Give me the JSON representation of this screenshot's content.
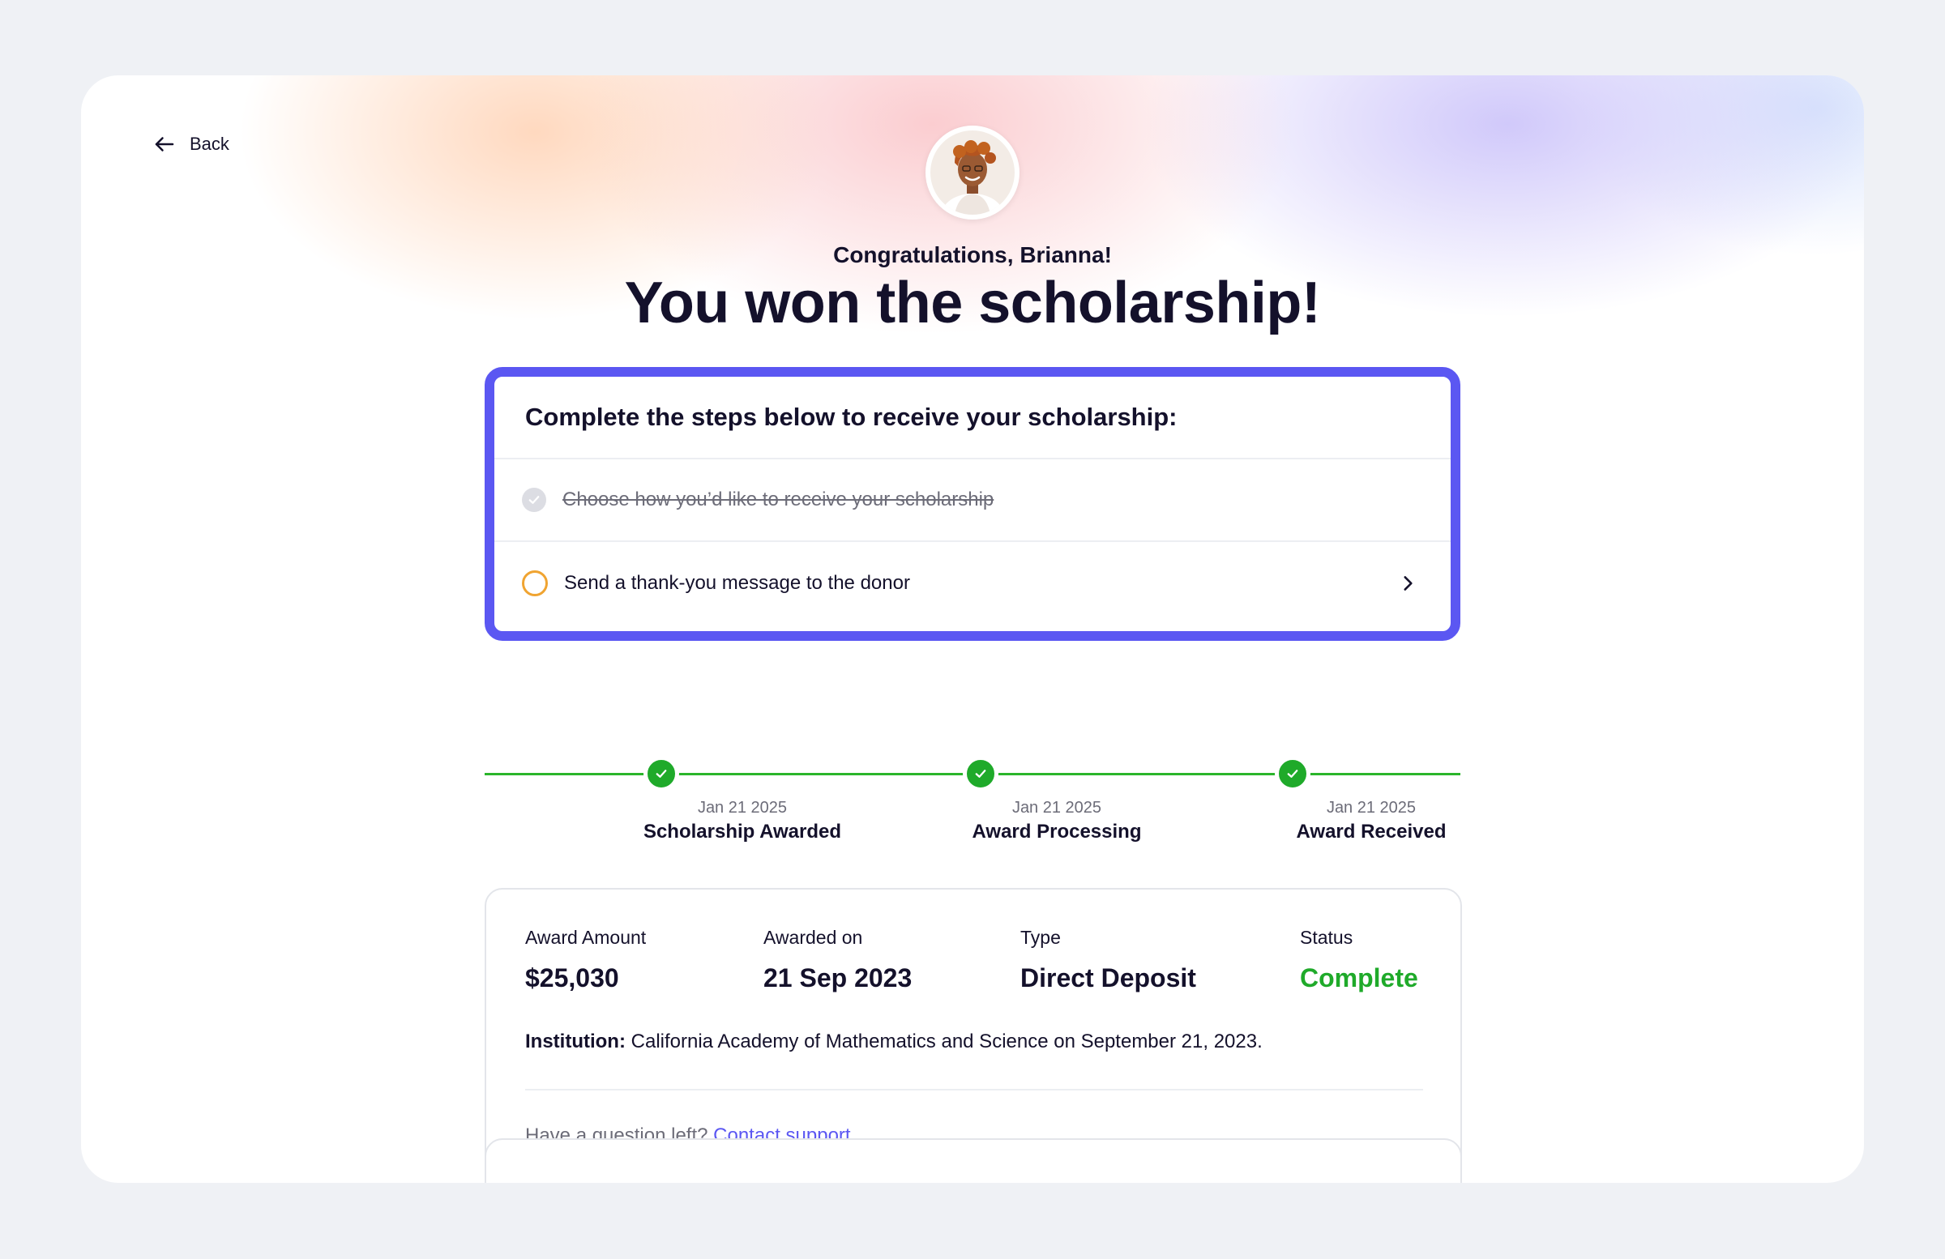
{
  "nav": {
    "back_label": "Back"
  },
  "hero": {
    "greeting": "Congratulations, Brianna!",
    "headline": "You won the scholarship!"
  },
  "steps": {
    "title": "Complete the steps below to receive your scholarship:",
    "items": [
      {
        "label": "Choose how you’d like to receive your scholarship",
        "done": true
      },
      {
        "label": "Send a thank-you message to the donor",
        "done": false
      }
    ]
  },
  "timeline": {
    "milestones": [
      {
        "date": "Jan 21 2025",
        "title": "Scholarship Awarded",
        "complete": true
      },
      {
        "date": "Jan 21 2025",
        "title": "Award Processing",
        "complete": true
      },
      {
        "date": "Jan 21 2025",
        "title": "Award Received",
        "complete": true
      }
    ]
  },
  "award": {
    "fields": [
      {
        "label": "Award Amount",
        "value": "$25,030"
      },
      {
        "label": "Awarded on",
        "value": "21 Sep 2023"
      },
      {
        "label": "Type",
        "value": "Direct Deposit"
      },
      {
        "label": "Status",
        "value": "Complete"
      }
    ],
    "institution_label": "Institution:",
    "institution_text": "California Academy of Mathematics and Science on September 21, 2023.",
    "support_prompt": "Have a question left?",
    "support_link": "Contact support"
  },
  "colors": {
    "accent": "#5b57f2",
    "success": "#1faa2a",
    "pending": "#f0a431",
    "text": "#14112b",
    "muted": "#6c6c78"
  },
  "icons": {
    "back": "arrow-left-icon",
    "done": "check-circle-icon",
    "pending": "empty-circle-icon",
    "open": "chevron-right-icon",
    "milestone": "check-circle-icon"
  }
}
